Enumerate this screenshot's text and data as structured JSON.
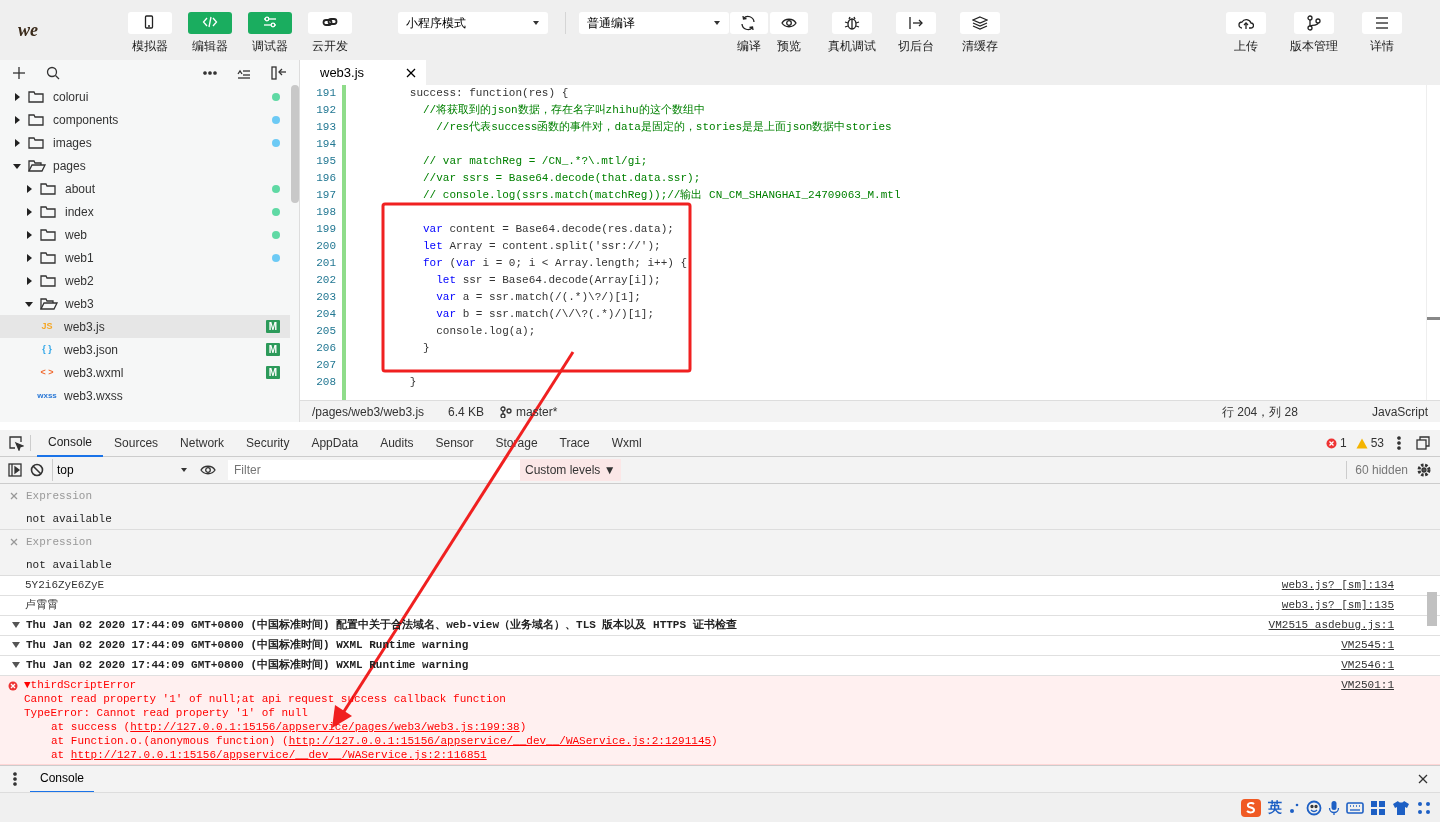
{
  "toolbar": {
    "logo": "we",
    "left_buttons": [
      {
        "label": "模拟器",
        "selected": false
      },
      {
        "label": "编辑器",
        "selected": true
      },
      {
        "label": "调试器",
        "selected": true
      },
      {
        "label": "云开发",
        "selected": false
      }
    ],
    "mode_select": "小程序模式",
    "compile_select": "普通编译",
    "actions": [
      "编译",
      "预览",
      "真机调试",
      "切后台",
      "清缓存"
    ],
    "right_buttons": [
      "上传",
      "版本管理",
      "详情"
    ]
  },
  "sidebar": {
    "items": [
      {
        "name": "colorui",
        "kind": "folder",
        "expanded": false,
        "color": "#5fd9a4"
      },
      {
        "name": "components",
        "kind": "folder",
        "expanded": false,
        "color": "#6ccaf5"
      },
      {
        "name": "images",
        "kind": "folder",
        "expanded": false,
        "color": "#6ccaf5"
      },
      {
        "name": "pages",
        "kind": "folder",
        "expanded": true,
        "children": [
          {
            "name": "about",
            "kind": "folder",
            "expanded": false,
            "color": "#5fd9a4"
          },
          {
            "name": "index",
            "kind": "folder",
            "expanded": false,
            "color": "#5fd9a4"
          },
          {
            "name": "web",
            "kind": "folder",
            "expanded": false,
            "color": "#5fd9a4"
          },
          {
            "name": "web1",
            "kind": "folder",
            "expanded": false,
            "color": "#6ccaf5"
          },
          {
            "name": "web2",
            "kind": "folder",
            "expanded": false
          },
          {
            "name": "web3",
            "kind": "folder",
            "expanded": true,
            "children": [
              {
                "name": "web3.js",
                "kind": "file",
                "type_label": "JS",
                "color": "#f5a623",
                "badge": "M",
                "selected": true
              },
              {
                "name": "web3.json",
                "kind": "file",
                "type_label": "{ }",
                "color": "#2aa4e8",
                "badge": "M",
                "selected": false
              },
              {
                "name": "web3.wxml",
                "kind": "file",
                "type_label": "< >",
                "color": "#f0692e",
                "badge": "M",
                "selected": false
              },
              {
                "name": "web3.wxss",
                "kind": "file",
                "type_label": "wxss",
                "color": "#2a78d6",
                "selected": false
              }
            ]
          }
        ]
      }
    ]
  },
  "editor": {
    "tab": "web3.js",
    "lines": [
      {
        "number": "191",
        "tokens": [
          {
            "text": "        success: function(res) {"
          }
        ]
      },
      {
        "number": "192",
        "tokens": [
          {
            "text": "          //将获取到的json数据，存在名字叫zhihu的这个数组中",
            "kind": "comment"
          }
        ]
      },
      {
        "number": "193",
        "tokens": [
          {
            "text": "            //res代表success函数的事件对，data是固定的，stories是是上面json数据中stories",
            "kind": "comment"
          }
        ]
      },
      {
        "number": "194"
      },
      {
        "number": "195",
        "tokens": [
          {
            "text": "          // var matchReg = /CN_.*?\\.mtl/gi;",
            "kind": "comment"
          }
        ]
      },
      {
        "number": "196",
        "tokens": [
          {
            "text": "          //var ssrs = Base64.decode(that.data.ssr);",
            "kind": "comment"
          }
        ]
      },
      {
        "number": "197",
        "tokens": [
          {
            "text": "          // console.log(ssrs.match(matchReg));//输出 CN_CM_SHANGHAI_24709063_M.mtl",
            "kind": "comment"
          }
        ]
      },
      {
        "number": "198"
      },
      {
        "number": "199",
        "tokens": [
          {
            "text": "          var",
            "kind": "keyword"
          },
          {
            "text": " content = Base64.decode(res.data);"
          }
        ]
      },
      {
        "number": "200",
        "tokens": [
          {
            "text": "          let",
            "kind": "keyword"
          },
          {
            "text": " Array = content.split('ssr://');"
          }
        ]
      },
      {
        "number": "201",
        "tokens": [
          {
            "text": "          for",
            "kind": "keyword"
          },
          {
            "text": " ("
          },
          {
            "text": "var",
            "kind": "keyword"
          },
          {
            "text": " i = 0; i < Array.length; i++) {"
          }
        ]
      },
      {
        "number": "202",
        "tokens": [
          {
            "text": "            let",
            "kind": "keyword"
          },
          {
            "text": " ssr = Base64.decode(Array[i]);"
          }
        ]
      },
      {
        "number": "203",
        "tokens": [
          {
            "text": "            var",
            "kind": "keyword"
          },
          {
            "text": " a = ssr.match(/(.*)\\?/)[1];"
          }
        ]
      },
      {
        "number": "204",
        "tokens": [
          {
            "text": "            var",
            "kind": "keyword"
          },
          {
            "text": " b = ssr.match(/\\/\\?(.*)/)[1];"
          }
        ]
      },
      {
        "number": "205",
        "tokens": [
          {
            "text": "            console.log(a);"
          }
        ]
      },
      {
        "number": "206",
        "tokens": [
          {
            "text": "          }"
          }
        ]
      },
      {
        "number": "207"
      },
      {
        "number": "208",
        "tokens": [
          {
            "text": "        }"
          }
        ]
      }
    ],
    "status": {
      "path": "/pages/web3/web3.js",
      "size": "6.4 KB",
      "branch": "master*",
      "position": "行 204，列 28",
      "language": "JavaScript"
    }
  },
  "devtools": {
    "tabs": [
      {
        "label": "Console",
        "selected": true
      },
      {
        "label": "Sources",
        "selected": false
      },
      {
        "label": "Network",
        "selected": false
      },
      {
        "label": "Security",
        "selected": false
      },
      {
        "label": "AppData",
        "selected": false
      },
      {
        "label": "Audits",
        "selected": false
      },
      {
        "label": "Sensor",
        "selected": false
      },
      {
        "label": "Storage",
        "selected": false
      },
      {
        "label": "Trace",
        "selected": false
      },
      {
        "label": "Wxml",
        "selected": false
      }
    ],
    "error_count": "1",
    "warning_count": "53",
    "context": "top",
    "filter_placeholder": "Filter",
    "levels": "Custom levels ▼",
    "hidden": "60 hidden",
    "expressions": [
      {
        "label": "Expression",
        "value": "not available"
      },
      {
        "label": "Expression",
        "value": "not available"
      }
    ],
    "messages": [
      {
        "kind": "log",
        "text": "5Y2i6ZyE6ZyE",
        "source": "web3.js? [sm]:134"
      },
      {
        "kind": "log",
        "text": "卢霄霄",
        "source": "web3.js? [sm]:135"
      },
      {
        "kind": "group",
        "text": "Thu Jan 02 2020 17:44:09 GMT+0800 (中国标准时间) 配置中关于合法域名、web-view（业务域名）、TLS 版本以及 HTTPS 证书检查",
        "source": "VM2515 asdebug.js:1"
      },
      {
        "kind": "group",
        "text": "Thu Jan 02 2020 17:44:09 GMT+0800 (中国标准时间) WXML Runtime warning",
        "source": "VM2545:1"
      },
      {
        "kind": "group",
        "text": "Thu Jan 02 2020 17:44:09 GMT+0800 (中国标准时间) WXML Runtime warning",
        "source": "VM2546:1"
      },
      {
        "kind": "error",
        "text": "▼thirdScriptError",
        "source": "VM2501:1",
        "lines": [
          "Cannot read property '1' of null;at api request success callback function",
          "TypeError: Cannot read property '1' of null"
        ],
        "stack": [
          {
            "prefix": "at success (",
            "link": "http://127.0.0.1:15156/appservice/pages/web3/web3.js:199:38",
            "suffix": ")"
          },
          {
            "prefix": "at Function.o.(anonymous function) (",
            "link": "http://127.0.0.1:15156/appservice/__dev__/WAService.js:2:1291145",
            "suffix": ")"
          },
          {
            "prefix": "at ",
            "link": "http://127.0.0.1:15156/appservice/__dev__/WAService.js:2:116851"
          }
        ]
      }
    ],
    "drawer_tab": "Console"
  },
  "ime": {
    "label": "英"
  }
}
